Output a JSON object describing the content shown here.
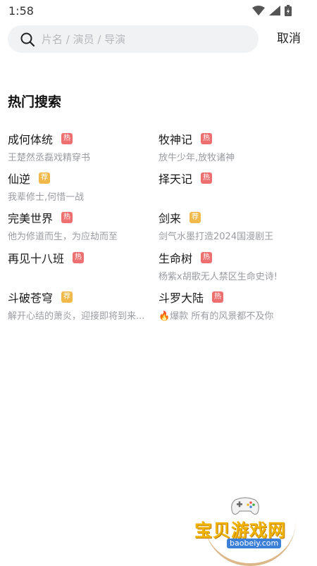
{
  "status_bar": {
    "time": "1:58"
  },
  "search": {
    "placeholder": "片名 / 演员 / 导演",
    "value": "",
    "cancel_label": "取消"
  },
  "hot_search": {
    "title": "热门搜索",
    "items": [
      {
        "title": "成何体统",
        "badge": "热",
        "badge_type": "hot",
        "subtitle": "王楚然丞磊戏精穿书"
      },
      {
        "title": "牧神记",
        "badge": "热",
        "badge_type": "hot",
        "subtitle": "放牛少年,放牧诸神"
      },
      {
        "title": "仙逆",
        "badge": "荐",
        "badge_type": "rec",
        "subtitle": "我辈修士,何惜一战"
      },
      {
        "title": "择天记",
        "badge": "热",
        "badge_type": "hot",
        "subtitle": ""
      },
      {
        "title": "完美世界",
        "badge": "热",
        "badge_type": "hot",
        "subtitle": "他为修道而生，为应劫而至"
      },
      {
        "title": "剑来",
        "badge": "荐",
        "badge_type": "rec",
        "subtitle": "剑气水墨打造2024国漫剧王"
      },
      {
        "title": "再见十八班",
        "badge": "热",
        "badge_type": "hot",
        "subtitle": ""
      },
      {
        "title": "生命树",
        "badge": "热",
        "badge_type": "hot",
        "subtitle": "杨紫x胡歌无人禁区生命史诗!"
      },
      {
        "title": "斗破苍穹",
        "badge": "荐",
        "badge_type": "rec",
        "subtitle": "解开心结的萧炎，迎接即将到来..."
      },
      {
        "title": "斗罗大陆",
        "badge": "热",
        "badge_type": "hot",
        "subtitle": "🔥爆款 所有的风景都不及你"
      }
    ]
  },
  "colors": {
    "hot_badge": "#ee6f6f",
    "rec_badge": "#f1b94a",
    "search_bg": "#f1f2f3",
    "subtitle": "#9a9ca1"
  },
  "watermark": {
    "text": "宝贝游戏网",
    "url": "baobeiy.com"
  }
}
